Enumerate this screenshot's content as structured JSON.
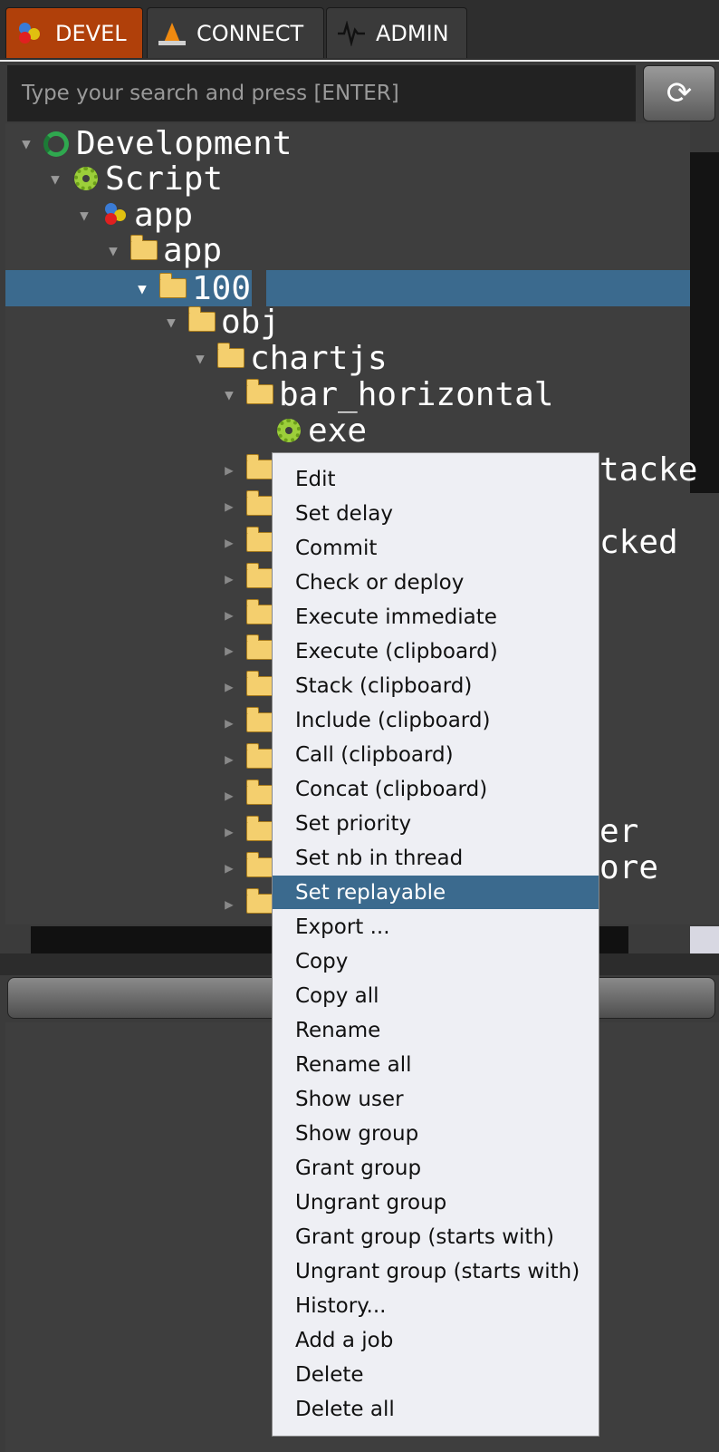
{
  "tabs": [
    {
      "label": "DEVEL",
      "icon": "color-dots-icon",
      "active": true
    },
    {
      "label": "CONNECT",
      "icon": "traffic-cone-icon",
      "active": false
    },
    {
      "label": "ADMIN",
      "icon": "pulse-icon",
      "active": false
    }
  ],
  "search": {
    "placeholder": "Type your search and press [ENTER]"
  },
  "refresh_icon": "⟳",
  "tree": {
    "nodes": [
      {
        "label": "Development",
        "icon": "recycle-icon"
      },
      {
        "label": "Script",
        "icon": "gear-icon"
      },
      {
        "label": "app",
        "icon": "color-dots-icon"
      },
      {
        "label": "app",
        "icon": "folder-icon"
      },
      {
        "label": "100",
        "icon": "folder-icon"
      },
      {
        "label": "obj",
        "icon": "folder-icon"
      },
      {
        "label": "chartjs",
        "icon": "folder-icon"
      },
      {
        "label": "bar_horizontal",
        "icon": "folder-icon"
      },
      {
        "label": "exe",
        "icon": "gear-icon"
      }
    ],
    "partial_labels": [
      "tacke",
      "cked",
      "er",
      "ore"
    ]
  },
  "context_menu": {
    "items": [
      "Edit",
      "Set delay",
      "Commit",
      "Check or deploy",
      "Execute immediate",
      "Execute (clipboard)",
      "Stack (clipboard)",
      "Include (clipboard)",
      "Call (clipboard)",
      "Concat (clipboard)",
      "Set priority",
      "Set nb in thread",
      "Set replayable",
      "Export ...",
      "Copy",
      "Copy all",
      "Rename",
      "Rename all",
      "Show user",
      "Show group",
      "Grant group",
      "Ungrant group",
      "Grant group (starts with)",
      "Ungrant group (starts with)",
      "History...",
      "Add a job",
      "Delete",
      "Delete all"
    ],
    "highlighted": "Set replayable"
  },
  "colors": {
    "active_tab": "#b0400a",
    "selection": "#3b6a8e",
    "folder": "#f4cf6e",
    "gear": "#9ccf3a"
  }
}
